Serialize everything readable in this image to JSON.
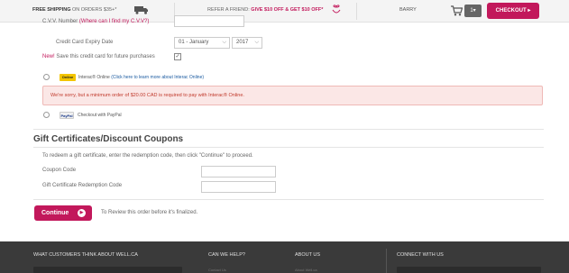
{
  "topbar": {
    "shipping_strong": "FREE SHIPPING",
    "shipping_text": "ON ORDERS $35+*",
    "refer_text": "REFER A FRIEND:",
    "refer_offer": "GIVE $10 OFF & GET $10 OFF*",
    "user_name": "BARRY",
    "cart_count": "1▾",
    "checkout_label": "CHECKOUT ▸"
  },
  "form": {
    "cvv_label": "C.V.V. Number",
    "cvv_link": "(Where can I find my C.V.V?)",
    "expiry_label": "Credit Card Expiry Date",
    "expiry_month": "01 - January",
    "expiry_year": "2017",
    "new_badge": "New!",
    "save_card_label": "Save this credit card for future purchases",
    "save_card_checked": "✓"
  },
  "payment_options": {
    "interac_logo": "Online",
    "interac_label": "Interac® Online",
    "interac_link": "(Click here to learn more about Interac Online)",
    "interac_alert": "We're sorry, but a minimum order of $20.00 CAD is required to pay with Interac® Online.",
    "paypal_logo": "PayPal",
    "paypal_label": "Checkout with PayPal"
  },
  "gift": {
    "title": "Gift Certificates/Discount Coupons",
    "help_text": "To redeem a gift certificate, enter the redemption code, then click \"Continue\" to proceed.",
    "coupon_label": "Coupon Code",
    "coupon_value": "",
    "gift_label": "Gift Certificate Redemption Code",
    "gift_value": ""
  },
  "actions": {
    "continue_label": "Continue",
    "continue_arrow": "▶",
    "review_text": "To Review this order before it's finalized."
  },
  "footer": {
    "col1": "WHAT CUSTOMERS THINK ABOUT WELL.CA",
    "col2": "CAN WE HELP?",
    "col3": "ABOUT US",
    "col4": "CONNECT WITH US",
    "col2_link": "Contact Us",
    "col3_link": "About Well.ca"
  },
  "colors": {
    "brand": "#c2185b",
    "alert_bg": "#fbe7e6",
    "footer_bg": "#3a3a3a"
  },
  "icons": [
    "truck-icon",
    "gift-icon",
    "cart-icon",
    "chevron-down-icon",
    "arrow-right-icon"
  ]
}
